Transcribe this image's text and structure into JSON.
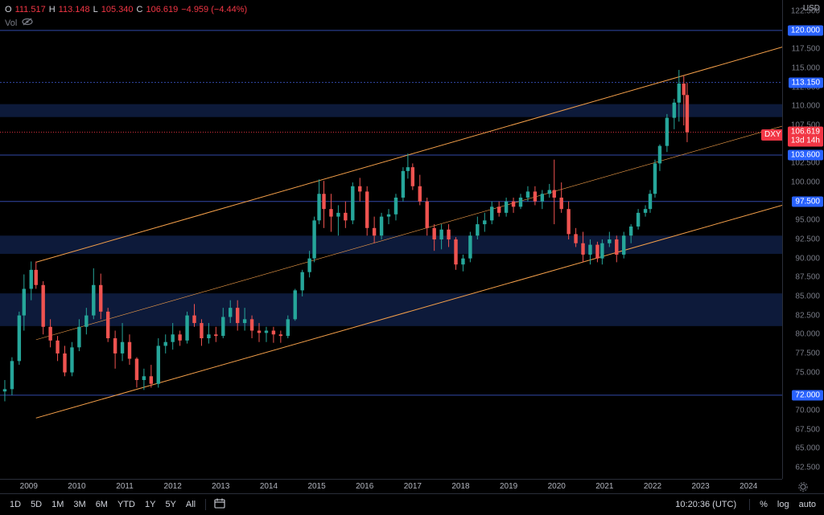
{
  "legend": {
    "o_label": "O",
    "o_value": "111.517",
    "h_label": "H",
    "h_value": "113.148",
    "l_label": "L",
    "l_value": "105.340",
    "c_label": "C",
    "c_value": "106.619",
    "change": "−4.959 (−4.44%)",
    "vol_label": "Vol"
  },
  "price_axis": {
    "currency": "USD",
    "ticks": [
      "122.500",
      "117.500",
      "115.000",
      "112.500",
      "110.000",
      "107.500",
      "105.000",
      "102.500",
      "100.000",
      "95.000",
      "92.500",
      "90.000",
      "87.500",
      "85.000",
      "82.500",
      "80.000",
      "77.500",
      "75.000",
      "70.000",
      "67.500",
      "65.000",
      "62.500"
    ],
    "tick_values": [
      122.5,
      117.5,
      115,
      112.5,
      110,
      107.5,
      105,
      102.5,
      100,
      95,
      92.5,
      90,
      87.5,
      85,
      82.5,
      80,
      77.5,
      75,
      70,
      67.5,
      65,
      62.5
    ],
    "level_tags": [
      {
        "label": "120.000",
        "value": 120
      },
      {
        "label": "113.150",
        "value": 113.15
      },
      {
        "label": "103.600",
        "value": 103.6
      },
      {
        "label": "97.500",
        "value": 97.5
      },
      {
        "label": "72.000",
        "value": 72
      }
    ],
    "last_price": {
      "label": "106.619",
      "countdown": "13d 14h",
      "value": 106.619
    },
    "symbol": "DXY"
  },
  "time_axis": {
    "years": [
      "2009",
      "2010",
      "2011",
      "2012",
      "2013",
      "2014",
      "2015",
      "2016",
      "2017",
      "2018",
      "2019",
      "2020",
      "2021",
      "2022",
      "2023",
      "2024"
    ]
  },
  "bottom_bar": {
    "ranges": [
      "1D",
      "5D",
      "1M",
      "3M",
      "6M",
      "YTD",
      "1Y",
      "5Y",
      "All"
    ],
    "clock": "10:20:36 (UTC)",
    "percent": "%",
    "log": "log",
    "auto": "auto"
  },
  "colors": {
    "up": "#26a69a",
    "down": "#ef5350",
    "zone": "#0d1a3a",
    "channel": "#f5a04a",
    "level": "#3249a8"
  },
  "chart_data": {
    "type": "candlestick",
    "y_range": [
      61,
      124
    ],
    "x_range": [
      2008.4,
      2024.7
    ],
    "zones": [
      [
        108.6,
        110.3
      ],
      [
        90.6,
        93.0
      ],
      [
        81.1,
        85.4
      ]
    ],
    "channel_upper": [
      [
        2009.15,
        89.5
      ],
      [
        2024.7,
        117.8
      ]
    ],
    "channel_lower": [
      [
        2009.15,
        69.0
      ],
      [
        2024.7,
        97.0
      ]
    ],
    "channel_mid": [
      [
        2009.15,
        79.3
      ],
      [
        2024.7,
        107.4
      ]
    ],
    "candles": [
      [
        2008.5,
        72.5,
        74.0,
        71.2,
        72.8
      ],
      [
        2008.65,
        72.8,
        77.0,
        72.0,
        76.5
      ],
      [
        2008.8,
        76.5,
        83.0,
        76.0,
        82.5
      ],
      [
        2008.9,
        82.5,
        87.9,
        80.5,
        86.0
      ],
      [
        2009.05,
        86.0,
        89.6,
        84.5,
        88.5
      ],
      [
        2009.15,
        88.5,
        89.6,
        86.0,
        86.5
      ],
      [
        2009.3,
        86.5,
        87.0,
        80.0,
        81.0
      ],
      [
        2009.45,
        81.0,
        82.0,
        78.3,
        79.2
      ],
      [
        2009.6,
        79.2,
        79.8,
        76.5,
        77.5
      ],
      [
        2009.75,
        77.5,
        78.5,
        74.5,
        75.0
      ],
      [
        2009.9,
        75.0,
        79.0,
        74.5,
        78.3
      ],
      [
        2010.05,
        78.3,
        82.0,
        77.8,
        81.0
      ],
      [
        2010.2,
        81.0,
        83.5,
        80.0,
        82.5
      ],
      [
        2010.35,
        82.5,
        88.7,
        82.0,
        86.5
      ],
      [
        2010.5,
        86.5,
        88.0,
        82.0,
        83.0
      ],
      [
        2010.65,
        83.0,
        83.5,
        79.0,
        79.5
      ],
      [
        2010.8,
        79.5,
        80.5,
        75.5,
        77.5
      ],
      [
        2010.95,
        77.5,
        81.5,
        76.5,
        79.0
      ],
      [
        2011.1,
        79.0,
        80.0,
        76.0,
        76.8
      ],
      [
        2011.25,
        76.8,
        77.0,
        73.0,
        74.0
      ],
      [
        2011.4,
        74.0,
        75.5,
        72.7,
        74.5
      ],
      [
        2011.55,
        74.5,
        76.0,
        73.0,
        73.5
      ],
      [
        2011.7,
        73.5,
        79.5,
        73.0,
        78.5
      ],
      [
        2011.85,
        78.5,
        80.0,
        77.5,
        79.0
      ],
      [
        2012.0,
        79.0,
        81.5,
        78.0,
        80.0
      ],
      [
        2012.15,
        80.0,
        80.5,
        78.5,
        79.2
      ],
      [
        2012.3,
        79.2,
        83.0,
        78.8,
        82.5
      ],
      [
        2012.45,
        82.5,
        84.0,
        81.0,
        81.5
      ],
      [
        2012.6,
        81.5,
        82.0,
        78.5,
        79.5
      ],
      [
        2012.75,
        79.5,
        81.5,
        78.8,
        80.0
      ],
      [
        2012.9,
        80.0,
        81.0,
        79.0,
        79.8
      ],
      [
        2013.05,
        79.8,
        83.5,
        79.5,
        82.3
      ],
      [
        2013.2,
        82.3,
        84.5,
        81.5,
        83.5
      ],
      [
        2013.35,
        83.5,
        84.5,
        80.5,
        81.5
      ],
      [
        2013.5,
        81.5,
        83.5,
        80.5,
        82.0
      ],
      [
        2013.65,
        82.0,
        82.5,
        79.5,
        80.5
      ],
      [
        2013.8,
        80.5,
        81.5,
        79.0,
        80.2
      ],
      [
        2013.95,
        80.2,
        81.0,
        79.0,
        80.5
      ],
      [
        2014.1,
        80.5,
        81.0,
        78.9,
        80.0
      ],
      [
        2014.25,
        80.0,
        80.5,
        78.9,
        79.8
      ],
      [
        2014.4,
        79.8,
        82.5,
        79.5,
        82.0
      ],
      [
        2014.55,
        82.0,
        86.0,
        81.8,
        85.8
      ],
      [
        2014.7,
        85.8,
        88.5,
        85.0,
        88.2
      ],
      [
        2014.85,
        88.2,
        91.0,
        87.5,
        90.0
      ],
      [
        2014.95,
        90.0,
        95.5,
        89.5,
        95.0
      ],
      [
        2015.05,
        95.0,
        100.4,
        94.5,
        98.5
      ],
      [
        2015.15,
        98.5,
        100.2,
        94.0,
        96.5
      ],
      [
        2015.3,
        96.5,
        98.5,
        93.5,
        95.5
      ],
      [
        2015.45,
        95.5,
        97.0,
        93.0,
        96.0
      ],
      [
        2015.6,
        96.0,
        97.5,
        94.0,
        95.0
      ],
      [
        2015.75,
        95.0,
        100.0,
        94.5,
        99.5
      ],
      [
        2015.9,
        99.5,
        100.6,
        97.5,
        98.8
      ],
      [
        2016.05,
        98.8,
        99.5,
        93.0,
        94.0
      ],
      [
        2016.2,
        94.0,
        95.5,
        92.0,
        93.0
      ],
      [
        2016.35,
        93.0,
        96.0,
        92.5,
        95.5
      ],
      [
        2016.5,
        95.5,
        96.5,
        94.5,
        95.8
      ],
      [
        2016.65,
        95.8,
        98.5,
        95.0,
        98.0
      ],
      [
        2016.8,
        98.0,
        102.0,
        97.5,
        101.5
      ],
      [
        2016.9,
        101.5,
        103.8,
        100.5,
        102.0
      ],
      [
        2017.0,
        102.0,
        102.5,
        99.0,
        99.5
      ],
      [
        2017.15,
        99.5,
        101.0,
        97.0,
        97.5
      ],
      [
        2017.3,
        97.5,
        98.0,
        93.0,
        94.0
      ],
      [
        2017.45,
        94.0,
        94.5,
        91.0,
        92.5
      ],
      [
        2017.6,
        92.5,
        94.5,
        91.2,
        93.8
      ],
      [
        2017.75,
        93.8,
        94.5,
        91.5,
        92.5
      ],
      [
        2017.9,
        92.5,
        92.8,
        88.5,
        89.2
      ],
      [
        2018.05,
        89.2,
        90.5,
        88.3,
        90.0
      ],
      [
        2018.2,
        90.0,
        93.5,
        89.5,
        93.0
      ],
      [
        2018.35,
        93.0,
        95.5,
        92.5,
        94.5
      ],
      [
        2018.5,
        94.5,
        96.0,
        93.5,
        95.0
      ],
      [
        2018.65,
        95.0,
        97.5,
        94.5,
        96.8
      ],
      [
        2018.8,
        96.8,
        97.5,
        95.5,
        96.0
      ],
      [
        2018.95,
        96.0,
        98.0,
        95.5,
        97.5
      ],
      [
        2019.1,
        97.5,
        98.0,
        96.0,
        96.8
      ],
      [
        2019.25,
        96.8,
        98.5,
        96.5,
        98.0
      ],
      [
        2019.4,
        98.0,
        99.5,
        97.5,
        98.8
      ],
      [
        2019.55,
        98.8,
        99.5,
        97.0,
        97.5
      ],
      [
        2019.7,
        97.5,
        99.0,
        96.5,
        98.5
      ],
      [
        2019.85,
        98.5,
        99.8,
        98.0,
        99.0
      ],
      [
        2019.95,
        99.0,
        103.0,
        94.5,
        98.0
      ],
      [
        2020.1,
        98.0,
        100.0,
        96.0,
        96.5
      ],
      [
        2020.25,
        96.5,
        97.5,
        92.5,
        93.2
      ],
      [
        2020.4,
        93.2,
        94.0,
        91.5,
        92.0
      ],
      [
        2020.55,
        92.0,
        93.5,
        89.5,
        90.5
      ],
      [
        2020.7,
        90.5,
        92.5,
        89.2,
        91.8
      ],
      [
        2020.85,
        91.8,
        92.2,
        89.5,
        90.0
      ],
      [
        2020.95,
        90.0,
        92.5,
        89.2,
        92.0
      ],
      [
        2021.1,
        92.0,
        93.5,
        91.5,
        92.5
      ],
      [
        2021.25,
        92.5,
        93.0,
        89.5,
        90.5
      ],
      [
        2021.4,
        90.5,
        93.5,
        90.0,
        93.0
      ],
      [
        2021.55,
        93.0,
        94.5,
        92.0,
        94.2
      ],
      [
        2021.7,
        94.2,
        96.5,
        93.8,
        96.0
      ],
      [
        2021.85,
        96.0,
        97.0,
        95.5,
        96.5
      ],
      [
        2021.95,
        96.5,
        99.0,
        96.0,
        98.5
      ],
      [
        2022.05,
        98.5,
        103.0,
        98.0,
        102.5
      ],
      [
        2022.15,
        102.5,
        105.0,
        101.5,
        104.8
      ],
      [
        2022.3,
        104.8,
        109.0,
        104.0,
        108.5
      ],
      [
        2022.45,
        108.5,
        111.0,
        107.0,
        110.5
      ],
      [
        2022.55,
        110.5,
        114.8,
        108.0,
        113.0
      ],
      [
        2022.65,
        113.0,
        114.0,
        107.5,
        111.5
      ],
      [
        2022.72,
        111.5,
        113.1,
        105.3,
        106.6
      ]
    ]
  }
}
